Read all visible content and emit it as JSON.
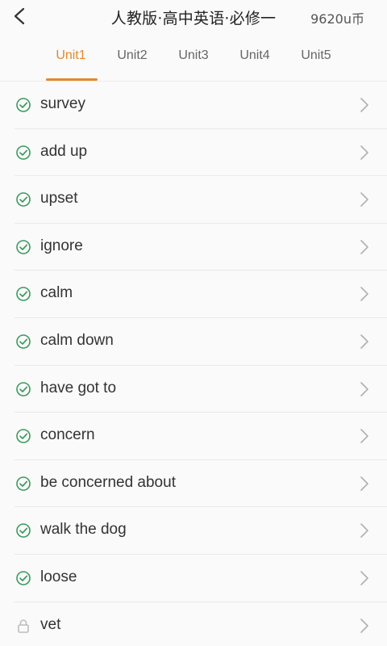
{
  "header": {
    "title": "人教版·高中英语·必修一",
    "coins": "9620u币"
  },
  "tabs": [
    {
      "label": "Unit1",
      "active": true
    },
    {
      "label": "Unit2",
      "active": false
    },
    {
      "label": "Unit3",
      "active": false
    },
    {
      "label": "Unit4",
      "active": false
    },
    {
      "label": "Unit5",
      "active": false
    }
  ],
  "colors": {
    "accent": "#e08a2e",
    "check_green": "#3a9a5e",
    "lock_gray": "#bdbdbd",
    "chevron_gray": "#b0b0b0"
  },
  "words": [
    {
      "label": "survey",
      "status": "completed"
    },
    {
      "label": "add up",
      "status": "completed"
    },
    {
      "label": "upset",
      "status": "completed"
    },
    {
      "label": "ignore",
      "status": "completed"
    },
    {
      "label": "calm",
      "status": "completed"
    },
    {
      "label": "calm down",
      "status": "completed"
    },
    {
      "label": "have got to",
      "status": "completed"
    },
    {
      "label": "concern",
      "status": "completed"
    },
    {
      "label": "be concerned about",
      "status": "completed"
    },
    {
      "label": "walk the dog",
      "status": "completed"
    },
    {
      "label": "loose",
      "status": "completed"
    },
    {
      "label": "vet",
      "status": "locked"
    }
  ]
}
